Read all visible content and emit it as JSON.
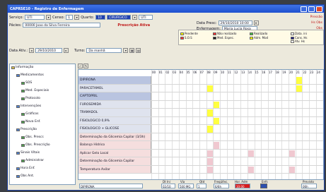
{
  "window": {
    "title": "CAPRSE10 - Registro de Enfermagem"
  },
  "header": {
    "servico_label": "Serviço:",
    "servico_value": "UTI",
    "census_label": "Censo:",
    "census_value": "1",
    "quarto_label": "Quarto:",
    "quarto_value": "10",
    "leito_value": "CIRURGICO",
    "leito_code": "UTI",
    "paciente_label": "Pácies:",
    "paciente_value": "00000 Joao da Silva Ferreira",
    "alert_text": "Prescrição Ativa",
    "data_presc_label": "Data Presc:",
    "data_presc_value": "29/10/2010 10:00",
    "enf_label": "Enfermagem:",
    "enf_value": "Maria Lucia Rosa",
    "data_atv_label": "Data Ativ.:",
    "data_atv_value": "29/10/2010",
    "turno_label": "Turno:",
    "turno_value": "Da manhã"
  },
  "side_links": [
    "Pressão",
    "Hs Obs",
    "Obs",
    "Tur. Bs"
  ],
  "legend": {
    "items": [
      {
        "label": "Pendente",
        "color": "#ffff00"
      },
      {
        "label": "Não realizado",
        "color": "#ff3030"
      },
      {
        "label": "Realizado",
        "color": "#40c040"
      },
      {
        "label": "Data. ini",
        "color": "#ffffff"
      },
      {
        "label": "S.O.S",
        "color": "#ff3030"
      },
      {
        "label": "Med. Espec.",
        "color": "#202020"
      },
      {
        "label": "Adm. Mod",
        "color": "#ffff00"
      },
      {
        "label": "Cons. Hs",
        "color": "#202080"
      },
      {
        "label": "Atv. Hs",
        "color": "#ffffff"
      }
    ]
  },
  "tree": {
    "items": [
      {
        "label": "Informação",
        "level": 0
      },
      {
        "label": "Medicamentos",
        "level": 1
      },
      {
        "label": "SOS",
        "level": 2
      },
      {
        "label": "Med. Especiais",
        "level": 2
      },
      {
        "label": "Protocolo",
        "level": 2
      },
      {
        "label": "Intervenções",
        "level": 1
      },
      {
        "label": "Gráficos",
        "level": 2
      },
      {
        "label": "Nova Enf.",
        "level": 2
      },
      {
        "label": "Prescrição",
        "level": 1
      },
      {
        "label": "Obs. Prescr.",
        "level": 2
      },
      {
        "label": "Obs. Prescrição",
        "level": 2
      },
      {
        "label": "Sinais Vitais",
        "level": 1
      },
      {
        "label": "Administrar",
        "level": 2
      },
      {
        "label": "Hora Enf.",
        "level": 1
      },
      {
        "label": "Obs Ant.",
        "level": 1
      }
    ]
  },
  "grid": {
    "hours": [
      "00",
      "01",
      "02",
      "03",
      "04",
      "05",
      "06",
      "07",
      "08",
      "09",
      "10",
      "11",
      "12",
      "13",
      "14",
      "15",
      "16",
      "17",
      "18",
      "19",
      "20",
      "21",
      "22",
      "23",
      "24"
    ],
    "rows": [
      {
        "name": "DIPIRONA",
        "bg": "#b9c4e0"
      },
      {
        "name": "PARACETAMOL",
        "bg": "#dfe3ee"
      },
      {
        "name": "CAPTOPRIL",
        "bg": "#b9c4e0"
      },
      {
        "name": "FUROSEMIDA",
        "bg": "#dfe3ee"
      },
      {
        "name": "TRAMADOL",
        "bg": "#dfe3ee"
      },
      {
        "name": "FISIOLOGICO 0,9%",
        "bg": "#dfe3ee"
      },
      {
        "name": "FISIOLOGICO + GLICOSE",
        "bg": "#dfe3ee"
      },
      {
        "name": "Determinação da Glicemia Capilar (3/3h)",
        "bg": "#f5dede"
      },
      {
        "name": "Balanço Hídrico",
        "bg": "#f5dede"
      },
      {
        "name": "Aplicar Gelo Local",
        "bg": "#f5dede"
      },
      {
        "name": "Determinação da Glicemia Capilar",
        "bg": "#f5dede"
      },
      {
        "name": "Temperatura Axilar",
        "bg": "#f5dede"
      }
    ]
  },
  "status": {
    "item_label": "",
    "item_value": "DIPIRONA",
    "dose_label": "Dt Ini",
    "dose_value": "02/10",
    "via_label": "Via",
    "via_value": "500 MG",
    "qtd_label": "Qtd",
    "qtd_value": "1",
    "freq_label": "Freqüênc.",
    "freq_value": "6/6h",
    "horario_label": "Hor. Adm",
    "horario_value": "10:00",
    "flag_label": "Enfs",
    "total_label": "Previsto",
    "total_value": "06h"
  }
}
